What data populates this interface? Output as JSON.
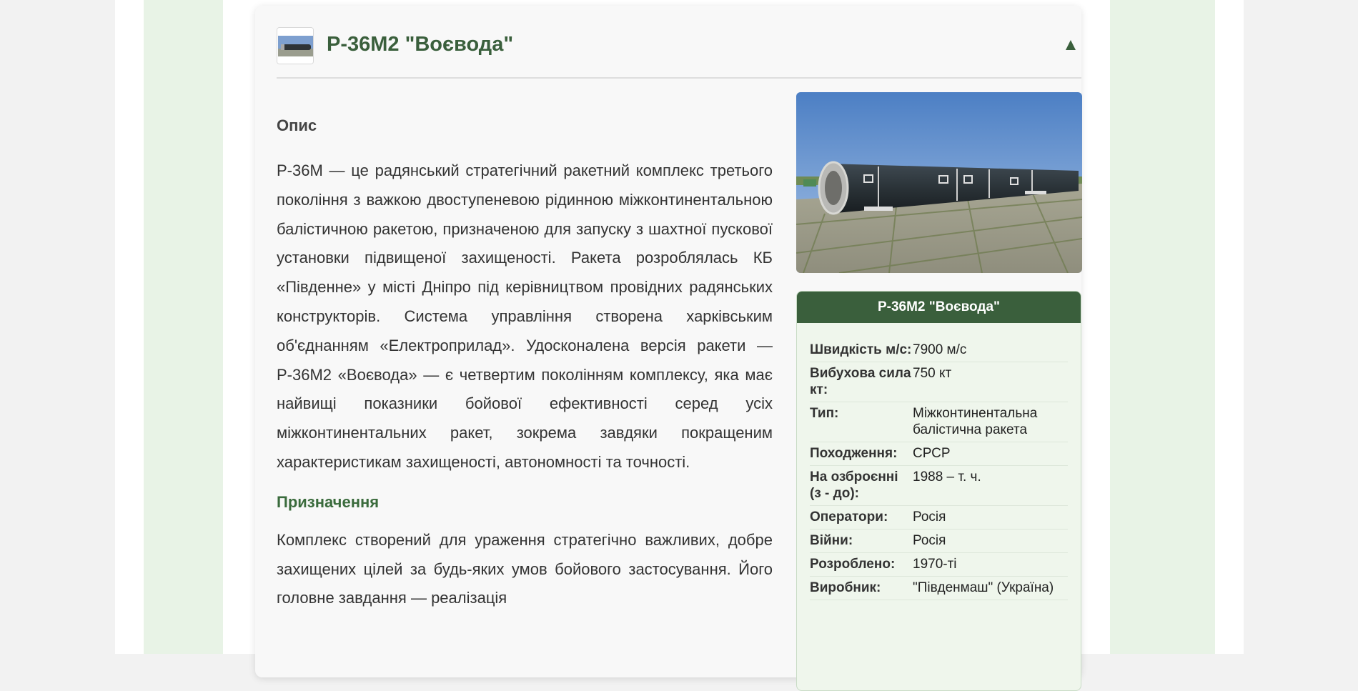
{
  "card": {
    "title": "Р-36М2 \"Воєвода\"",
    "collapse_glyph": "▲",
    "collapse_icon": "triangle-up-icon"
  },
  "sections": {
    "description_heading": "Опис",
    "description_text": "Р-36М — це радянський стратегічний ракетний комплекс третього покоління з важкою двоступеневою рідинною міжконтинентальною балістичною ракетою, призначеною для запуску з шахтної пускової установки підвищеної захищеності. Ракета розроблялась КБ «Південне» у місті Дніпро під керівництвом провідних радянських конструкторів. Система управління створена харківським об'єднанням «Електроприлад». Удосконалена версія ракети — Р-36М2 «Воєвода» — є четвертим поколінням комплексу, яка має найвищі показники бойової ефективності серед усіх міжконтинентальних ракет, зокрема завдяки покращеним характеристикам захищеності, автономності та точності.",
    "purpose_heading": "Призначення",
    "purpose_text": "Комплекс створений для ураження стратегічно важливих, добре захищених цілей за будь-яких умов бойового застосування. Його головне завдання — реалізація"
  },
  "infobox": {
    "title": "Р-36М2 \"Воєвода\"",
    "rows": [
      {
        "key": "Швидкість м/с:",
        "value": "7900 м/с"
      },
      {
        "key": "Вибухова сила кт:",
        "value": "750 кт"
      },
      {
        "key": "Тип:",
        "value": "Міжконтинентальна балістична ракета"
      },
      {
        "key": "Походження:",
        "value": "СРСР"
      },
      {
        "key": "На озброєнні (з - до):",
        "value": "1988 – т. ч."
      },
      {
        "key": "Оператори:",
        "value": "Росія"
      },
      {
        "key": "Війни:",
        "value": "Росія"
      },
      {
        "key": "Розроблено:",
        "value": "1970-ті"
      },
      {
        "key": "Виробник:",
        "value": "\"Південмаш\" (Україна)"
      }
    ]
  },
  "colors": {
    "accent": "#3a5f3c",
    "page_bg": "#f2f2f2",
    "green_strip": "#e8f3e6",
    "infobox_bg": "#eff6ec"
  }
}
